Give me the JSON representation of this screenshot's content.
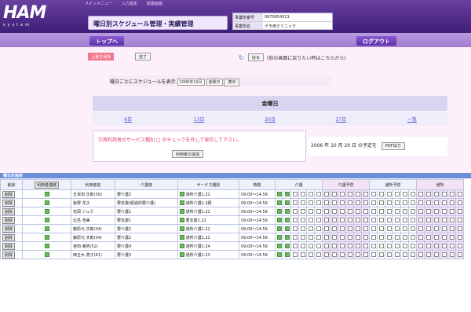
{
  "header": {
    "logo_main": "HAM",
    "logo_sub": "system",
    "nav": [
      "メインメニュー",
      "入力指定",
      "関連画面"
    ],
    "app_title": "曜日別スケジュール管理・実績管理",
    "info": [
      {
        "key": "事業所番号",
        "value": "0870654321"
      },
      {
        "key": "事業所名",
        "value": "デモ用クリニック"
      }
    ]
  },
  "buttons": {
    "top": "トップへ",
    "logout": "ログアウト",
    "back": "戻る",
    "ok": "完了",
    "display": "表示",
    "user_reg": "利用者の追加",
    "pdf": "PDF出力",
    "contact": "利用者連絡",
    "red": "上書き保存"
  },
  "notice": "(前の画面に戻りたい時はこちらから)",
  "display_line": {
    "label": "曜日ごとにスケジュールを表示",
    "month": "2006年10月",
    "day": "金曜日"
  },
  "weekday": {
    "title": "金曜日",
    "dates": [
      "6日",
      "13日",
      "20日",
      "27日",
      "一覧"
    ]
  },
  "service_notice": "欠席利用者のサービス種別 □ のチェックを外して保存して下さい。",
  "date_summary": "2006 年 10 月 20 日 の予定を",
  "section_label": "曜日計画表",
  "table": {
    "headers": [
      "削除",
      "利用者名",
      "介護度",
      "サービス種別",
      "時間"
    ],
    "group_labels": [
      "介護",
      "介護予防",
      "通所予防",
      "通所"
    ],
    "rows": [
      {
        "name": "五百田 次郎(30)",
        "care": "要介護2",
        "service": "通所介護1.22",
        "time": "09:00～14:59"
      },
      {
        "name": "板野 花子",
        "care": "要支援(経過的要介護)",
        "service": "通所介護1.2経",
        "time": "09:00～14:59"
      },
      {
        "name": "花岡 ジュク",
        "care": "要介護1",
        "service": "通所介護1.22",
        "time": "09:00～14:59"
      },
      {
        "name": "北島 浩美",
        "care": "要支援1",
        "service": "要支援1.22",
        "time": "09:00～14:59"
      },
      {
        "name": "藤原元 次郎(34)",
        "care": "要介護2",
        "service": "通所介護1.22",
        "time": "09:00～14:59"
      },
      {
        "name": "藤原元 天郎(34)",
        "care": "要介護2",
        "service": "通所介護1.22",
        "time": "09:00～14:59"
      },
      {
        "name": "宮田 義男(52)",
        "care": "要介護4",
        "service": "通所介護1.24",
        "time": "09:00～14:59"
      },
      {
        "name": "西丘木 恵子(61)",
        "care": "要介護3",
        "service": "通所介護1.23",
        "time": "09:00～14:59"
      }
    ]
  }
}
